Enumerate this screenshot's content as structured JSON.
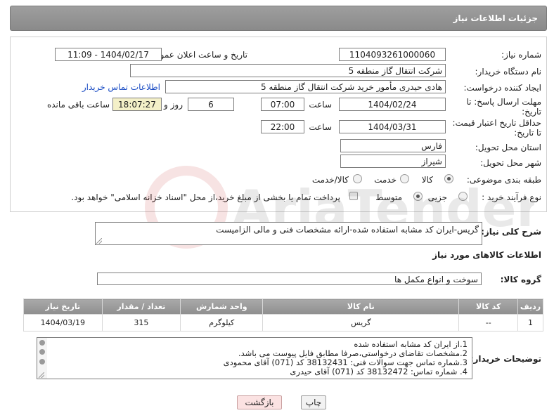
{
  "header": {
    "title": "جزئیات اطلاعات نیاز"
  },
  "form": {
    "need_number": {
      "label": "شماره نیاز:",
      "value": "1104093261000060"
    },
    "announce_datetime": {
      "label": "تاریخ و ساعت اعلان عمومی:",
      "value": "1404/02/17 - 11:09"
    },
    "buyer_org": {
      "label": "نام دستگاه خریدار:",
      "value": "شرکت انتقال گاز منطقه 5"
    },
    "requester": {
      "label": "ایجاد کننده درخواست:",
      "value": "هادی حیدری مأمور خرید شرکت انتقال گاز منطقه 5",
      "contact_link": "اطلاعات تماس خریدار"
    },
    "reply_deadline": {
      "label_line1": "مهلت ارسال پاسخ: تا",
      "label_line2": "تاریخ:",
      "date": "1404/02/24",
      "time_label": "ساعت",
      "time": "07:00",
      "days": "6",
      "days_label": "روز و",
      "remaining": "18:07:27",
      "remaining_label": "ساعت باقی مانده"
    },
    "price_validity": {
      "label_line1": "حداقل تاریخ اعتبار قیمت:",
      "label_line2": "تا تاریخ:",
      "date": "1404/03/31",
      "time_label": "ساعت",
      "time": "22:00"
    },
    "province": {
      "label": "استان محل تحویل:",
      "value": "فارس"
    },
    "city": {
      "label": "شهر محل تحویل:",
      "value": "شیراز"
    },
    "category": {
      "label": "طبقه بندی موضوعی:",
      "options": [
        "کالا",
        "خدمت",
        "کالا/خدمت"
      ],
      "selected": "کالا"
    },
    "purchase_type": {
      "label": "نوع فرآیند خرید :",
      "options": [
        "جزیی",
        "متوسط"
      ],
      "selected": "متوسط",
      "checkbox_text": "پرداخت تمام یا بخشی از مبلغ خرید،از محل \"اسناد خزانه اسلامی\" خواهد بود."
    }
  },
  "description": {
    "label": "شرح کلی نیاز:",
    "value": "گریس-ایران کد مشابه استفاده شده-ارائه مشخصات فنی و مالی الزامیست"
  },
  "goods_section": {
    "title": "اطلاعات کالاهای مورد نیاز",
    "group_label": "گروه کالا:",
    "group_value": "سوخت و انواع مکمل ها"
  },
  "items_table": {
    "headers": [
      "ردیف",
      "کد کالا",
      "نام کالا",
      "واحد شمارش",
      "تعداد / مقدار",
      "تاریخ نیاز"
    ],
    "rows": [
      [
        "1",
        "--",
        "گریس",
        "کیلوگرم",
        "315",
        "1404/03/19"
      ]
    ]
  },
  "buyer_notes": {
    "label": "توضیحات خریدار:",
    "lines": [
      "1.از ایران کد مشابه استفاده شده",
      "2.مشخصات تقاضای درخواستی،صرفا مطابق فایل پیوست می باشد.",
      "3.شماره تماس جهت سوالات فنی: 38132431 کد (071) آقای محمودی",
      "4. شماره تماس:  38132472 کد (071) آقای حیدری"
    ]
  },
  "buttons": {
    "print": "چاپ",
    "back": "بازگشت"
  },
  "watermark": {
    "text": "AriaTender.net"
  }
}
